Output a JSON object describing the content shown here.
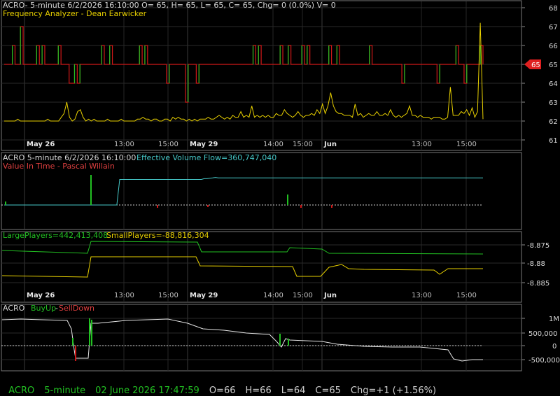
{
  "colors": {
    "bg": "#000000",
    "grid": "#2a2a2a",
    "axis": "#8a8a8a",
    "red": "#d01818",
    "green": "#22c022",
    "yellow": "#e8d000",
    "cyan": "#46c8c8",
    "white": "#e6e6e6",
    "price_badge": "#e02020"
  },
  "chart_data": [
    {
      "type": "line",
      "header": "ACRO- 5-minute 6/2/2026 16:10:00 O= 65, H= 65, L= 65, C= 65, Chg= 0 (0.0%) V= 0",
      "subtitle": "Frequency Analyzer - Dean Earwicker",
      "ylim": [
        61,
        68
      ],
      "yticks": [
        "68",
        "67",
        "66",
        "65",
        "64",
        "63",
        "62",
        "61"
      ],
      "last_price_badge": "65",
      "series": [
        {
          "name": "price",
          "color": "red",
          "step": true,
          "values": [
            65,
            65,
            65,
            66,
            65,
            65,
            67,
            65,
            65,
            65,
            65,
            65,
            66,
            65,
            66,
            65,
            65,
            65,
            65,
            65,
            66,
            65,
            65,
            65,
            64,
            64,
            65,
            64,
            65,
            65,
            65,
            65,
            65,
            65,
            65,
            65,
            66,
            65,
            65,
            66,
            65,
            65,
            65,
            65,
            65,
            65,
            65,
            65,
            65,
            65,
            66,
            65,
            66,
            65,
            65,
            65,
            65,
            65,
            65,
            65,
            64,
            65,
            65,
            65,
            65,
            65,
            65,
            63,
            65,
            65,
            65,
            64,
            65,
            65,
            65,
            65,
            65,
            65,
            65,
            65,
            65,
            65,
            65,
            65,
            65,
            65,
            65,
            65,
            65,
            65,
            65,
            65,
            66,
            65,
            66,
            65,
            65,
            65,
            65,
            65,
            65,
            65,
            66,
            65,
            65,
            66,
            65,
            65,
            65,
            65,
            66,
            65,
            66,
            65,
            65,
            65,
            65,
            65,
            65,
            65,
            66,
            65,
            65,
            66,
            65,
            65,
            65,
            65,
            65,
            65,
            65,
            65,
            65,
            65,
            65,
            66,
            65,
            65,
            65,
            65,
            65,
            65,
            65,
            65,
            65,
            65,
            65,
            64,
            65,
            65,
            65,
            65,
            65,
            65,
            65,
            65,
            65,
            65,
            65,
            65,
            64,
            65,
            65,
            65,
            65,
            65,
            65,
            66,
            65,
            65,
            64,
            65,
            65,
            65,
            65,
            65,
            66,
            65
          ]
        },
        {
          "name": "frequency",
          "color": "yellow",
          "values": [
            62,
            62,
            62,
            62,
            62,
            62.1,
            62,
            62,
            62,
            62,
            62,
            62,
            62,
            62,
            62,
            62,
            62.1,
            62,
            62,
            62,
            62,
            62.2,
            62.4,
            63,
            62.2,
            62,
            62.1,
            62.5,
            62.6,
            62.2,
            62,
            62.1,
            62,
            62.1,
            62,
            62,
            62,
            62,
            62.1,
            62,
            62,
            62,
            62,
            62.1,
            62,
            62,
            62,
            62,
            62,
            62.1,
            62.1,
            62.2,
            62.1,
            62.1,
            62,
            62.1,
            62.1,
            62,
            62,
            62.1,
            62.1,
            62,
            62.2,
            62.1,
            62.2,
            62.1,
            62.1,
            62,
            62.1,
            62,
            62.1,
            62,
            62.1,
            62.1,
            62.1,
            62.2,
            62.1,
            62.1,
            62.2,
            62.3,
            62.2,
            62.1,
            62.2,
            62.1,
            62.3,
            62.2,
            62.2,
            62.5,
            62.2,
            62.3,
            62.2,
            62.8,
            62.2,
            62.3,
            62.2,
            62.3,
            62.2,
            62.3,
            62.2,
            62.2,
            62.4,
            62.3,
            62.3,
            62.6,
            62.4,
            62.3,
            62.2,
            62.3,
            62.5,
            62.3,
            62.2,
            62.3,
            62.3,
            62.4,
            62.3,
            62.6,
            62.4,
            62.9,
            62.4,
            62.8,
            63.5,
            62.8,
            62.5,
            62.4,
            62.4,
            62.3,
            62.3,
            62.3,
            62.2,
            62.9,
            62.3,
            62.4,
            62.2,
            62.3,
            62.4,
            62.3,
            62.3,
            62.5,
            62.3,
            62.3,
            62.4,
            62.3,
            62.6,
            62.3,
            62.2,
            62.3,
            62.2,
            62.3,
            62.4,
            62.8,
            62.3,
            62.3,
            62.2,
            62.3,
            62.2,
            62.2,
            62.2,
            62.1,
            62.2,
            62.2,
            62.2,
            62.1,
            62.1,
            62.2,
            63.8,
            62.3,
            62.3,
            62.3,
            62.5,
            62.4,
            62.6,
            62.3,
            62.7,
            62.2,
            62.5,
            67.2,
            62.1
          ]
        }
      ]
    },
    {
      "type": "line",
      "header": "ACRO 5-minute  6/2/2026 16:10:00",
      "series_label": "Effective Volume Flow=360,747,040",
      "subtitle": "Value In Time - Pascal Willain",
      "series": [
        {
          "name": "evf",
          "color": "cyan",
          "values": [
            0,
            0,
            0,
            0,
            0,
            0,
            0,
            0,
            0,
            0,
            0,
            0,
            0,
            0,
            0,
            0,
            0,
            0,
            0,
            0,
            0,
            0,
            0,
            0,
            0,
            0,
            0,
            0,
            0,
            0,
            0,
            0,
            0,
            0,
            0,
            0,
            0,
            0,
            0,
            0,
            0,
            10,
            10,
            10,
            10,
            10,
            10,
            10,
            10,
            10,
            10,
            10,
            10,
            10,
            10,
            10,
            10,
            10,
            10,
            10,
            10,
            10,
            10,
            10,
            10,
            10,
            10,
            10,
            10,
            10,
            10,
            10.3,
            10.3,
            10.5,
            10.6,
            10.8,
            10.6,
            10.6,
            10.6,
            10.6,
            10.6,
            10.6,
            10.6,
            10.6,
            10.6,
            10.6,
            10.6,
            10.6,
            10.6,
            10.6,
            10.6,
            10.6,
            10.6,
            10.6,
            10.6,
            10.6,
            10.6,
            10.6,
            10.6,
            10.6,
            10.6,
            10.6,
            10.6,
            10.6,
            10.6,
            10.6,
            10.6,
            10.6,
            10.6,
            10.6,
            10.6,
            10.6,
            10.6,
            10.6,
            10.6,
            10.6,
            10.6,
            10.6,
            10.6,
            10.6,
            10.6,
            10.6,
            10.6,
            10.6,
            10.6,
            10.6,
            10.6,
            10.6,
            10.6,
            10.6,
            10.6,
            10.6,
            10.6,
            10.6,
            10.6,
            10.6,
            10.6,
            10.6,
            10.6,
            10.6,
            10.6,
            10.6,
            10.6,
            10.6,
            10.6,
            10.6,
            10.6,
            10.6,
            10.6,
            10.6,
            10.6,
            10.6,
            10.6,
            10.6,
            10.6,
            10.6,
            10.6,
            10.6,
            10.6,
            10.6,
            10.6,
            10.6,
            10.6,
            10.6,
            10.6,
            10.6,
            10.6,
            10.6,
            10.6,
            10.6,
            10.6
          ]
        }
      ]
    },
    {
      "type": "line",
      "series_label_large": "LargePlayers=442,413,408",
      "series_label_small": "SmallPlayers=-88,816,304",
      "ylim": [
        -8.89,
        -8.87
      ],
      "yticks": [
        "-8.875",
        "-8.88",
        "-8.885"
      ],
      "series": [
        {
          "name": "large",
          "color": "green",
          "values": []
        },
        {
          "name": "small",
          "color": "yellow",
          "values": []
        }
      ]
    },
    {
      "type": "line",
      "header": "ACRO",
      "buy_label": "BuyUp",
      "sell_label": "SellDown",
      "yticks": [
        "1M",
        "500,000",
        "0",
        "-500,000"
      ],
      "series": [
        {
          "name": "buyup",
          "color": "white",
          "values": []
        }
      ]
    }
  ],
  "x_axis": {
    "labels": [
      "May 26",
      "13:00",
      "15:00",
      "May 29",
      "14:00",
      "15:00",
      "Jun",
      "13:00",
      "15:00"
    ]
  },
  "status": {
    "symbol": "ACRO",
    "interval": "5-minute",
    "datetime": "02 June 2026 17:47:59",
    "open": "O=66",
    "high": "H=66",
    "low": "L=64",
    "close": "C=65",
    "change": "Chg=+1 (+1.56%)"
  }
}
